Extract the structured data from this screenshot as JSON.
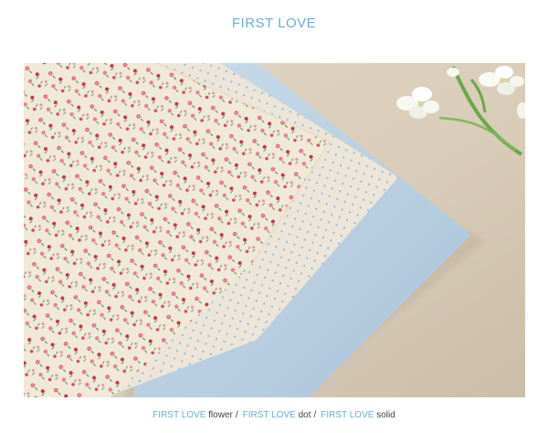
{
  "header": {
    "title": "FIRST LOVE"
  },
  "photo": {
    "alt": "",
    "colors": {
      "background": "#d9cdbb",
      "solid_fabric": "#bdd3e4",
      "dot_fabric": "#ece5d8",
      "dot": "#8ab8dc",
      "flower_fabric": "#f1e9d7",
      "flower_pink": "#e0607f",
      "flower_red": "#c8324c",
      "leaf_green": "#4f9a52"
    }
  },
  "caption": {
    "items": [
      {
        "brand": "FIRST LOVE",
        "variant": "flower",
        "separator": "/"
      },
      {
        "brand": "FIRST LOVE",
        "variant": "dot",
        "separator": "/"
      },
      {
        "brand": "FIRST LOVE",
        "variant": "solid",
        "separator": ""
      }
    ]
  }
}
